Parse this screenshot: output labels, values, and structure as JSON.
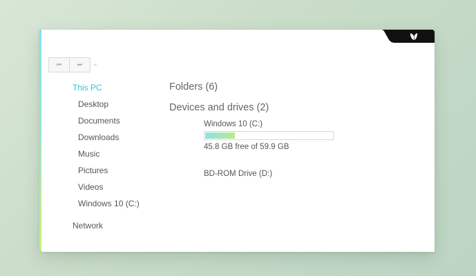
{
  "navigation": {
    "back_icon": "back-icon",
    "forward_icon": "forward-icon",
    "back_glyph": "⏮",
    "forward_glyph": "⏭",
    "history_dropdown_glyph": "⌄"
  },
  "sidebar": {
    "items": [
      {
        "label": "This PC",
        "active": true
      },
      {
        "label": "Desktop"
      },
      {
        "label": "Documents"
      },
      {
        "label": "Downloads"
      },
      {
        "label": "Music"
      },
      {
        "label": "Pictures"
      },
      {
        "label": "Videos"
      },
      {
        "label": "Windows 10 (C:)"
      },
      {
        "label": "Network"
      }
    ]
  },
  "main": {
    "folders_header": "Folders (6)",
    "devices_header": "Devices and drives (2)",
    "drives": [
      {
        "name": "Windows 10 (C:)",
        "free_text": "45.8 GB free of 59.9 GB",
        "used_fraction": 0.235
      },
      {
        "name": "BD-ROM Drive (D:)"
      }
    ]
  },
  "colors": {
    "accent": "#2cc6d6",
    "accent_green": "#b8ec8c",
    "badge_dark": "#111111"
  },
  "icons": {
    "titlebar_logo": "leaf-logo-icon"
  }
}
